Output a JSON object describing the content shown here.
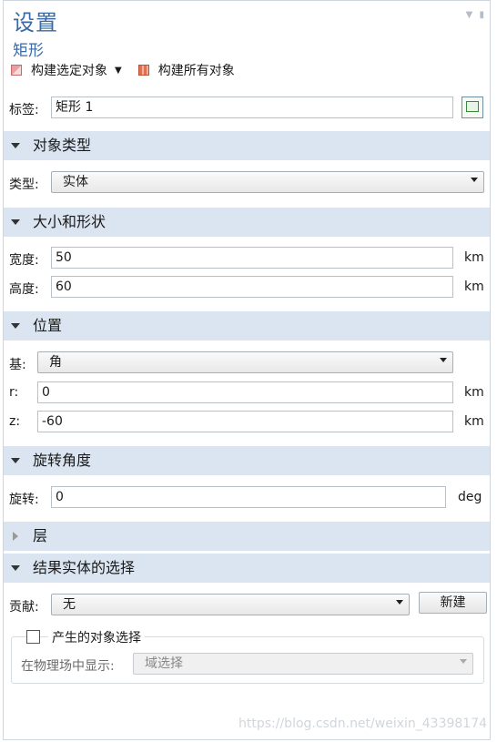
{
  "header": {
    "title": "设置",
    "subtitle": "矩形"
  },
  "toolbar": {
    "build_selected": "构建选定对象",
    "build_all": "构建所有对象"
  },
  "label_row": {
    "label": "标签:",
    "value": "矩形 1"
  },
  "sections": {
    "object_type": "对象类型",
    "size_shape": "大小和形状",
    "position": "位置",
    "rotation": "旋转角度",
    "layers": "层",
    "selections": "结果实体的选择"
  },
  "object_type": {
    "label": "类型:",
    "value": "实体"
  },
  "size": {
    "width_label": "宽度:",
    "width_value": "50",
    "width_unit": "km",
    "height_label": "高度:",
    "height_value": "60",
    "height_unit": "km"
  },
  "position": {
    "base_label": "基:",
    "base_value": "角",
    "r_label": "r:",
    "r_value": "0",
    "r_unit": "km",
    "z_label": "z:",
    "z_value": "-60",
    "z_unit": "km"
  },
  "rotation": {
    "label": "旋转:",
    "value": "0",
    "unit": "deg"
  },
  "selection": {
    "contribute_label": "贡献:",
    "contribute_value": "无",
    "new_button": "新建",
    "group_checkbox_label": "产生的对象选择",
    "checkbox_checked": false,
    "show_in_physics_label": "在物理场中显示:",
    "show_in_physics_value": "域选择"
  },
  "watermark": "https://blog.csdn.net/weixin_43398174"
}
